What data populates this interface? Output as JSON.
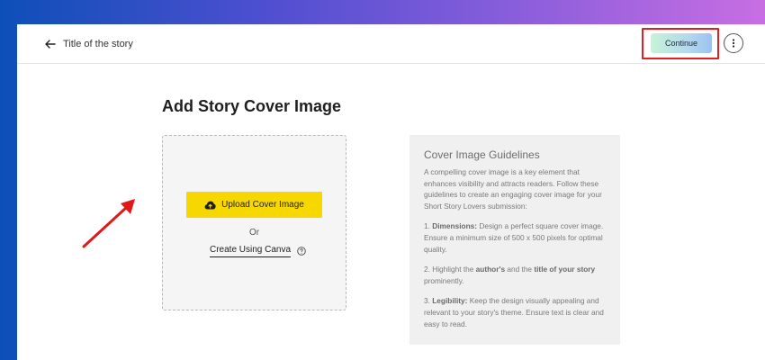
{
  "header": {
    "story_title": "Title of the story",
    "continue_label": "Continue"
  },
  "main": {
    "heading": "Add Story Cover Image",
    "upload_label": "Upload Cover Image",
    "or_label": "Or",
    "canva_label": "Create Using Canva"
  },
  "guidelines": {
    "title": "Cover Image Guidelines",
    "intro": "A compelling cover image is a key element that enhances visibility and attracts readers. Follow these guidelines to create an engaging cover image for your Short Story Lovers submission:",
    "item1_prefix": "1. ",
    "item1_bold": "Dimensions:",
    "item1_text": " Design a perfect square cover image. Ensure a minimum size of 500 x 500 pixels for optimal quality.",
    "item2_a": "2. Highlight the ",
    "item2_b1": "author's",
    "item2_c": " and the ",
    "item2_b2": "title of your story",
    "item2_d": " prominently.",
    "item3_prefix": "3. ",
    "item3_bold": "Legibility:",
    "item3_text": " Keep the design visually appealing and relevant to your story's theme. Ensure text is clear and easy to read."
  },
  "colors": {
    "accent_yellow": "#f6d800",
    "highlight_red": "#e02020",
    "arrow_red": "#e01818"
  },
  "icons": {
    "back": "arrow-left-icon",
    "more": "vertical-dots-icon",
    "upload": "cloud-upload-icon",
    "help": "question-circle-icon"
  }
}
